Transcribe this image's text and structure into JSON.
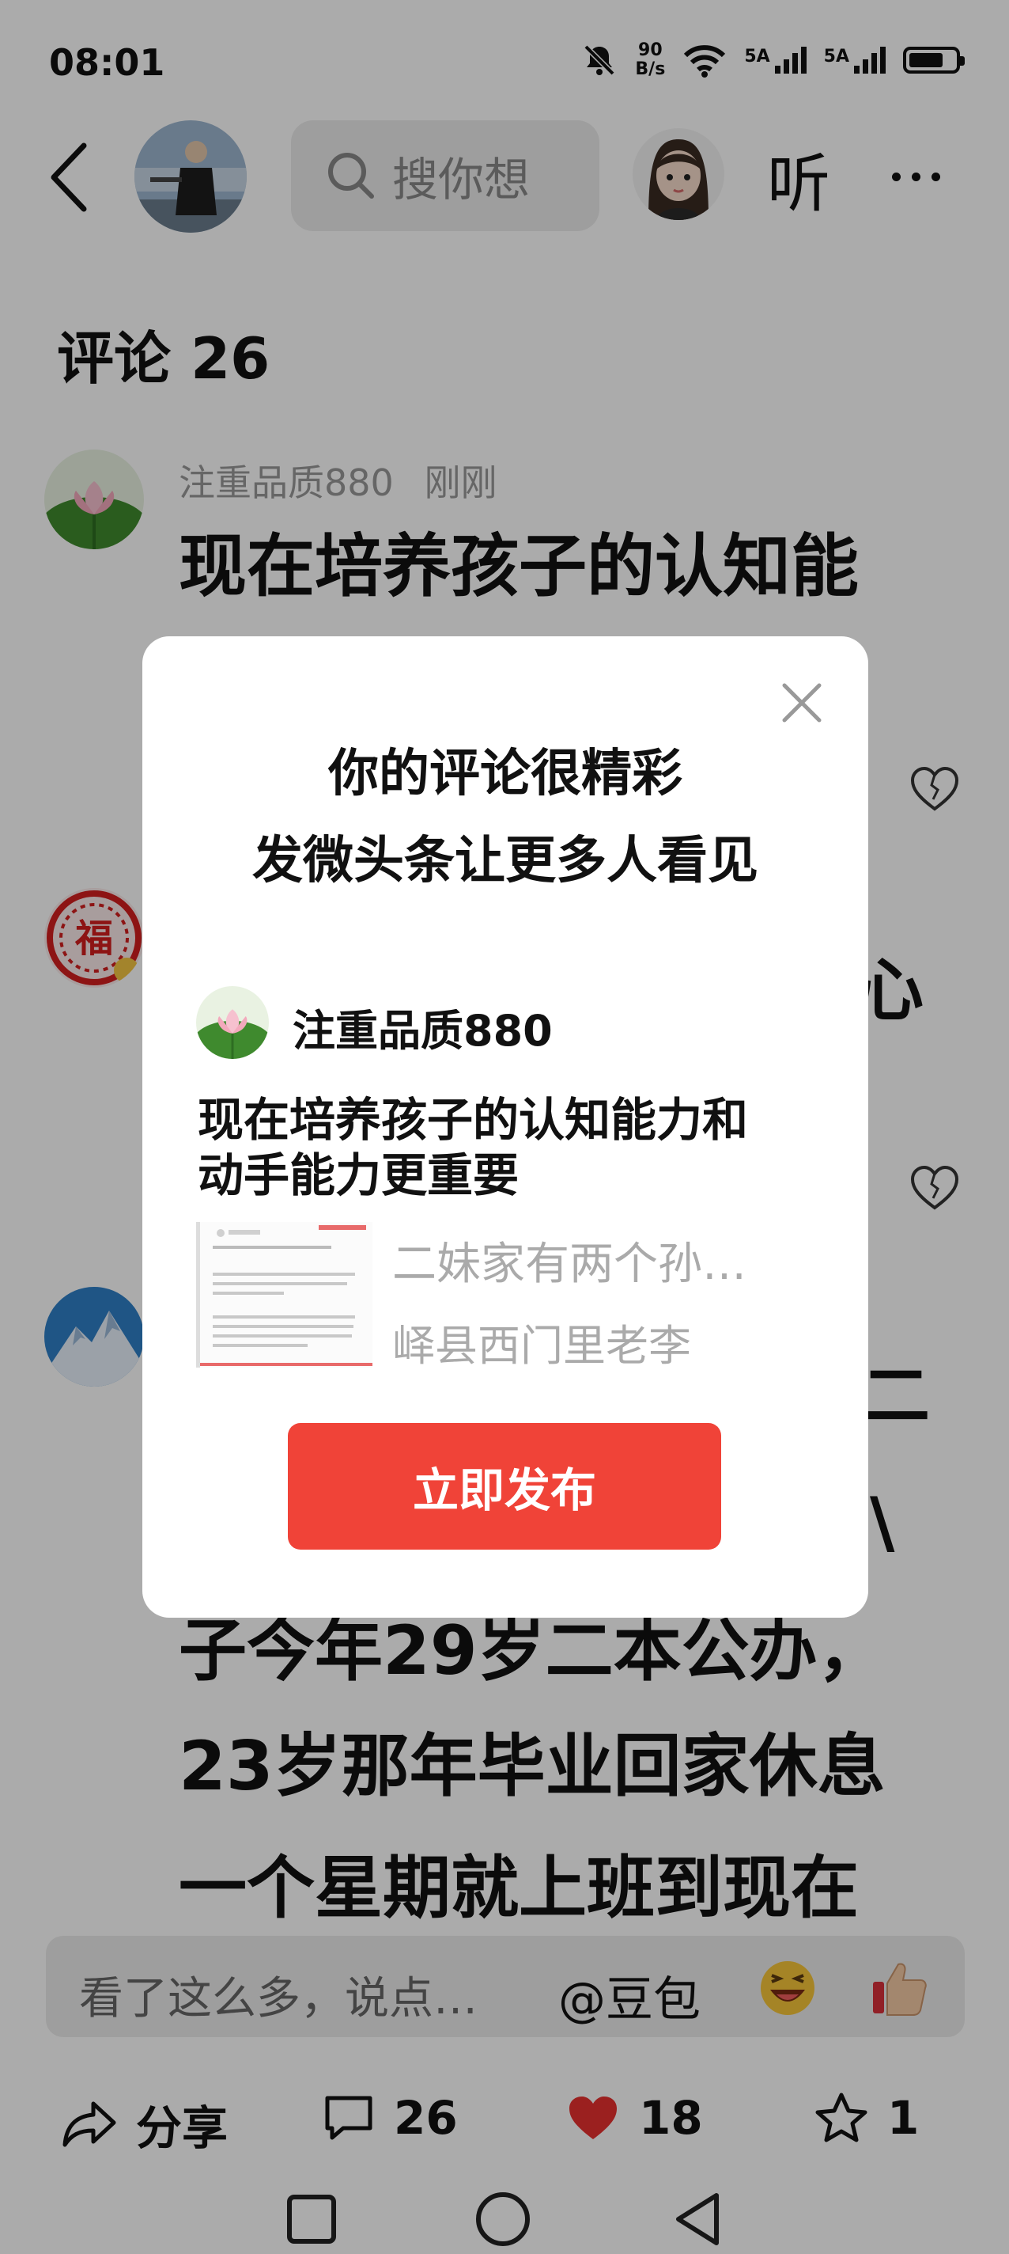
{
  "status_bar": {
    "time": "08:01",
    "net_speed_value": "90",
    "net_speed_unit": "B/s",
    "sim1_label": "5A",
    "sim2_label": "5A",
    "battery_level": 0.75,
    "icons": [
      "mute-bell-icon",
      "wifi-icon",
      "signal-icon",
      "battery-icon"
    ]
  },
  "header": {
    "search_placeholder": "搜你想",
    "listen_label": "听",
    "icons": [
      "back-arrow-icon",
      "search-icon",
      "more-icon"
    ]
  },
  "comments": {
    "title": "评论 26",
    "items": [
      {
        "username": "注重品质880",
        "time": "刚刚",
        "text_line1": "现在培养孩子的认知能"
      },
      {
        "text_partial": "心"
      },
      {
        "text_partial_1": "二",
        "text_partial_2": "\\",
        "text_line_a": "子今年29岁二本公办，",
        "text_line_b": "23岁那年毕业回家休息",
        "text_line_c": "一个星期就上班到现在"
      }
    ]
  },
  "modal": {
    "title_line1": "你的评论很精彩",
    "title_line2": "发微头条让更多人看见",
    "username": "注重品质880",
    "comment_line1": "现在培养孩子的认知能力和",
    "comment_line2": "动手能力更重要",
    "ref_title": "二妹家有两个孙…",
    "ref_author": "峄县西门里老李",
    "publish_label": "立即发布"
  },
  "comment_input": {
    "placeholder": "看了这么多，说点…",
    "at_label": "@豆包"
  },
  "actions": {
    "share_label": "分享",
    "comment_count": "26",
    "like_count": "18",
    "favorite_count": "1"
  },
  "colors": {
    "accent_red": "#f04338",
    "like_red": "#e8312f",
    "overlay": "rgba(0,0,0,0.33)"
  }
}
